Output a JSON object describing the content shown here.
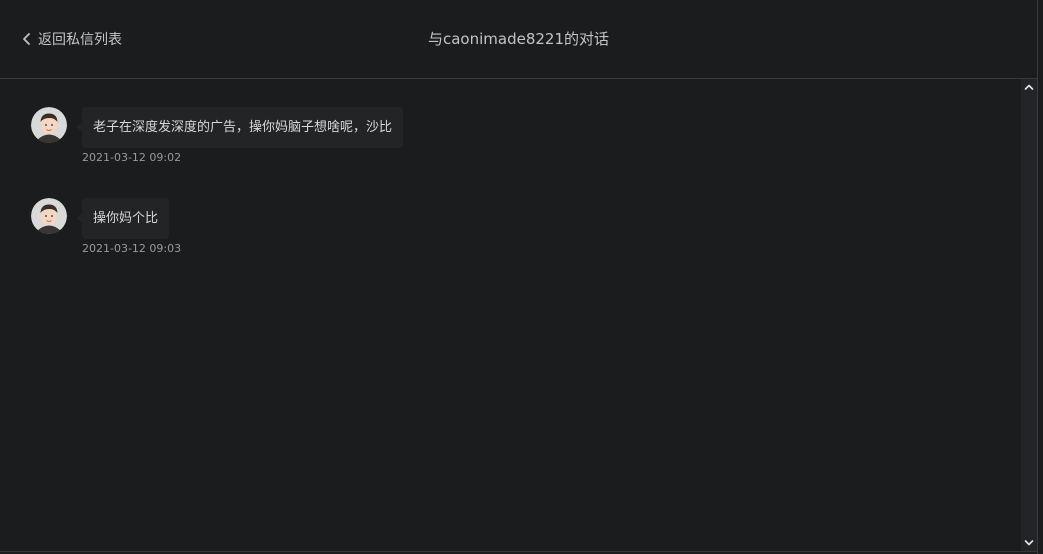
{
  "header": {
    "back_label": "返回私信列表",
    "title": "与caonimade8221的对话"
  },
  "messages": [
    {
      "text": "老子在深度发深度的广告，操你妈脑子想啥呢，沙比",
      "time": "2021-03-12 09:02",
      "avatar": "user-avatar-icon"
    },
    {
      "text": "操你妈个比",
      "time": "2021-03-12 09:03",
      "avatar": "user-avatar-icon"
    }
  ],
  "icons": {
    "back": "chevron-left-icon",
    "scroll_up": "chevron-up-icon",
    "scroll_down": "chevron-down-icon"
  },
  "colors": {
    "background": "#1b1c1e",
    "bubble": "#232426",
    "text": "#d8d8d8",
    "muted": "#9a9a9a"
  }
}
